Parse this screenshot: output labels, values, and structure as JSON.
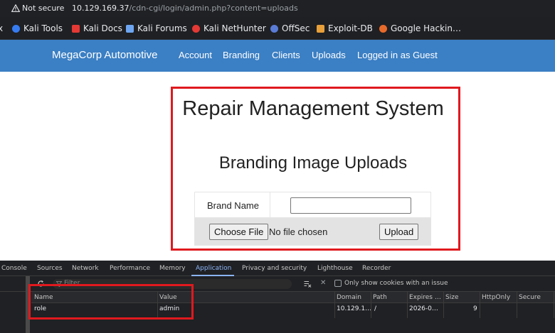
{
  "browser": {
    "security_label": "Not secure",
    "url_host": "10.129.169.37",
    "url_path": "/cdn-cgi/login/admin.php?content=uploads"
  },
  "bookmarks": [
    {
      "label": "Kali Tools",
      "icon": "kali-icon",
      "color": "#367bf0"
    },
    {
      "label": "Kali Docs",
      "icon": "docs-icon",
      "color": "#e53935"
    },
    {
      "label": "Kali Forums",
      "icon": "forums-icon",
      "color": "#6ea6f2"
    },
    {
      "label": "Kali NetHunter",
      "icon": "nethunter-icon",
      "color": "#e53935"
    },
    {
      "label": "OffSec",
      "icon": "offsec-icon",
      "color": "#5a7bd6"
    },
    {
      "label": "Exploit-DB",
      "icon": "exploitdb-icon",
      "color": "#e8a03a"
    },
    {
      "label": "Google Hackin…",
      "icon": "ghdb-icon",
      "color": "#e86a2b"
    }
  ],
  "navbar": {
    "brand": "MegaCorp Automotive",
    "links": [
      "Account",
      "Branding",
      "Clients",
      "Uploads",
      "Logged in as Guest"
    ],
    "color": "#3b7fc4"
  },
  "page": {
    "title": "Repair Management System",
    "subtitle": "Branding Image Uploads",
    "brand_name_label": "Brand Name",
    "brand_name_value": "",
    "choose_file_label": "Choose File",
    "no_file_text": "No file chosen",
    "upload_label": "Upload"
  },
  "devtools": {
    "tabs": [
      "Console",
      "Sources",
      "Network",
      "Performance",
      "Memory",
      "Application",
      "Privacy and security",
      "Lighthouse",
      "Recorder"
    ],
    "active_tab": "Application",
    "filter_placeholder": "Filter",
    "only_issue_label": "Only show cookies with an issue",
    "columns": [
      "Name",
      "Value",
      "Domain",
      "Path",
      "Expires …",
      "Size",
      "HttpOnly",
      "Secure"
    ],
    "rows": [
      {
        "name": "role",
        "value": "admin",
        "domain": "10.129.1…",
        "path": "/",
        "expires": "2026-0…",
        "size": "9"
      }
    ]
  },
  "highlight_color": "#e0191e"
}
